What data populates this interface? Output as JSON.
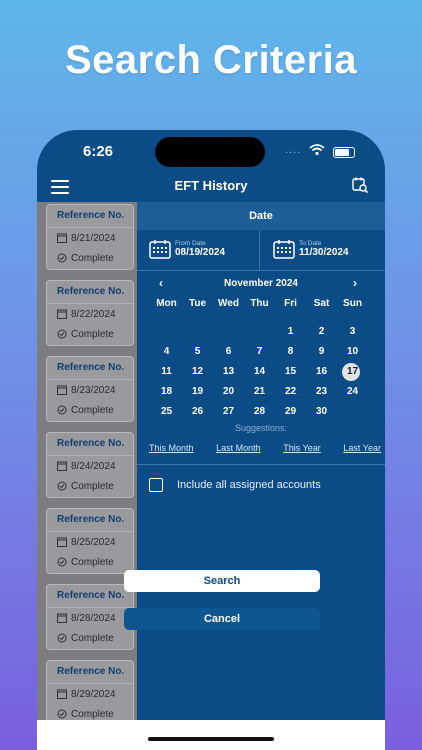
{
  "headline": "Search Criteria",
  "status": {
    "time": "6:26",
    "signal": "...."
  },
  "nav": {
    "title": "EFT History"
  },
  "list": {
    "cards": [
      {
        "ref": "Reference No.",
        "date": "8/21/2024",
        "status": "Complete"
      },
      {
        "ref": "Reference No.",
        "date": "8/22/2024",
        "status": "Complete"
      },
      {
        "ref": "Reference No.",
        "date": "8/23/2024",
        "status": "Complete"
      },
      {
        "ref": "Reference No.",
        "date": "8/24/2024",
        "status": "Complete"
      },
      {
        "ref": "Reference No.",
        "date": "8/25/2024",
        "status": "Complete"
      },
      {
        "ref": "Reference No.",
        "date": "8/28/2024",
        "status": "Complete"
      },
      {
        "ref": "Reference No.",
        "date": "8/29/2024",
        "status": "Complete"
      }
    ]
  },
  "panel": {
    "header": "Date",
    "from_label": "From Date",
    "from_value": "08/19/2024",
    "to_label": "To Date",
    "to_value": "11/30/2024",
    "calendar": {
      "prev": "‹",
      "next": "›",
      "month": "November 2024",
      "weekdays": [
        "Mon",
        "Tue",
        "Wed",
        "Thu",
        "Fri",
        "Sat",
        "Sun"
      ],
      "weeks": [
        [
          "",
          "",
          "",
          "",
          "1",
          "2",
          "3"
        ],
        [
          "4",
          "5",
          "6",
          "7",
          "8",
          "9",
          "10"
        ],
        [
          "11",
          "12",
          "13",
          "14",
          "15",
          "16",
          "17"
        ],
        [
          "18",
          "19",
          "20",
          "21",
          "22",
          "23",
          "24"
        ],
        [
          "25",
          "26",
          "27",
          "28",
          "29",
          "30",
          ""
        ]
      ],
      "selected_day": "17"
    },
    "suggestions_label": "Suggestions:",
    "suggestions": [
      "This Month",
      "Last Month",
      "This Year",
      "Last Year"
    ],
    "include_label": "Include all assigned accounts",
    "include_checked": false
  },
  "buttons": {
    "search": "Search",
    "cancel": "Cancel"
  },
  "colors": {
    "primary": "#0b4b86",
    "header_band": "#1e5e97",
    "overlay_gray": "#7d7d80"
  }
}
